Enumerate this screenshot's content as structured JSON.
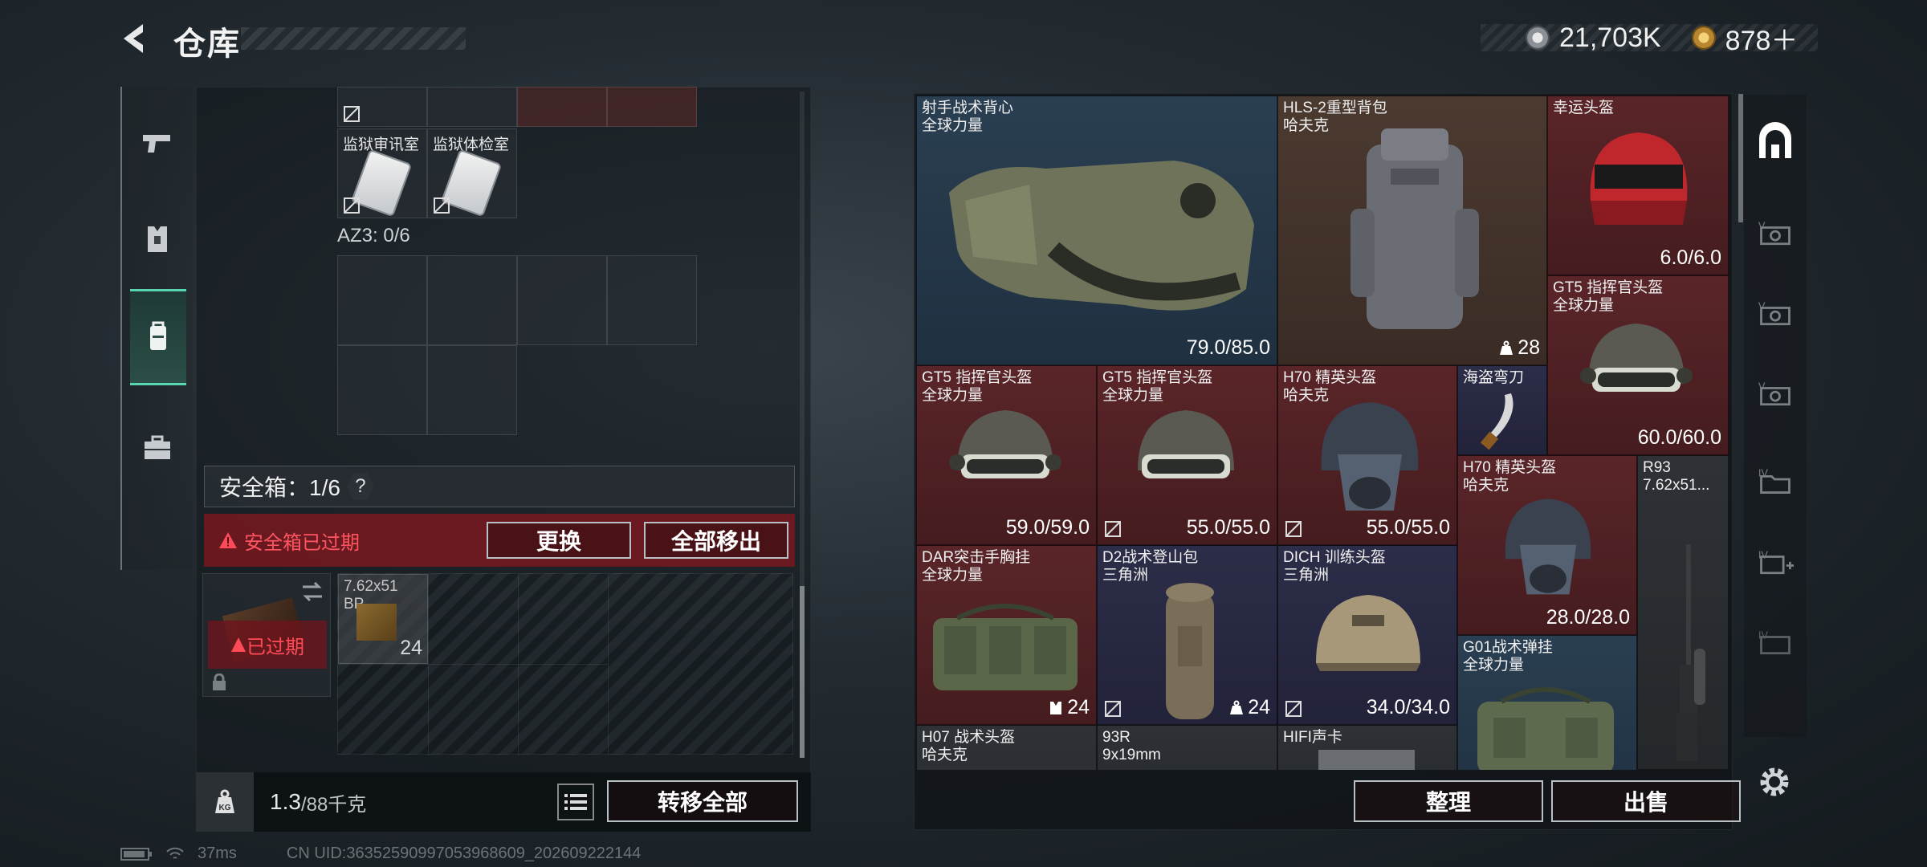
{
  "header": {
    "title": "仓库"
  },
  "currency": {
    "silver": "21,703K",
    "gold": "878＋"
  },
  "left": {
    "tiles": [
      {
        "label": "监狱审讯室"
      },
      {
        "label": "监狱体检室"
      }
    ],
    "az3_label": "AZ3: 0/6",
    "safe_box": {
      "label": "安全箱：1/6",
      "help": "?"
    },
    "expired": {
      "message": "安全箱已过期",
      "replace": "更换",
      "remove_all": "全部移出",
      "badge": "已过期"
    },
    "ammo": {
      "name": "7.62x51",
      "sub": "BP",
      "count": "24"
    },
    "weight": {
      "current": "1.3",
      "max": "/88千克"
    },
    "transfer_all": "转移全部"
  },
  "stash": {
    "items": [
      {
        "name": "射手战术背心",
        "sub": "全球力量",
        "value": "79.0/85.0"
      },
      {
        "name": "HLS-2重型背包",
        "sub": "哈夫克",
        "value": "28"
      },
      {
        "name": "幸运头盔",
        "sub": "",
        "value": "6.0/6.0"
      },
      {
        "name": "GT5 指挥官头盔",
        "sub": "全球力量",
        "value": "60.0/60.0"
      },
      {
        "name": "GT5 指挥官头盔",
        "sub": "全球力量",
        "value": "59.0/59.0"
      },
      {
        "name": "GT5 指挥官头盔",
        "sub": "全球力量",
        "value": "55.0/55.0"
      },
      {
        "name": "H70 精英头盔",
        "sub": "哈夫克",
        "value": "55.0/55.0"
      },
      {
        "name": "海盗弯刀",
        "sub": "",
        "value": ""
      },
      {
        "name": "H70 精英头盔",
        "sub": "哈夫克",
        "value": "28.0/28.0"
      },
      {
        "name": "R93",
        "sub": "7.62x51...",
        "value": ""
      },
      {
        "name": "DAR突击手胸挂",
        "sub": "全球力量",
        "value": "24"
      },
      {
        "name": "D2战术登山包",
        "sub": "三角洲",
        "value": "24"
      },
      {
        "name": "DICH 训练头盔",
        "sub": "三角洲",
        "value": "34.0/34.0"
      },
      {
        "name": "G01战术弹挂",
        "sub": "全球力量",
        "value": ""
      },
      {
        "name": "H07 战术头盔",
        "sub": "哈夫克",
        "value": ""
      },
      {
        "name": "93R",
        "sub": "9x19mm",
        "value": ""
      },
      {
        "name": "HIFI声卡",
        "sub": "",
        "value": ""
      }
    ],
    "sort": "整理",
    "sell": "出售"
  },
  "status": {
    "ping": "37ms",
    "uid": "CN UID:3635259099705396860​9_202609222144"
  }
}
